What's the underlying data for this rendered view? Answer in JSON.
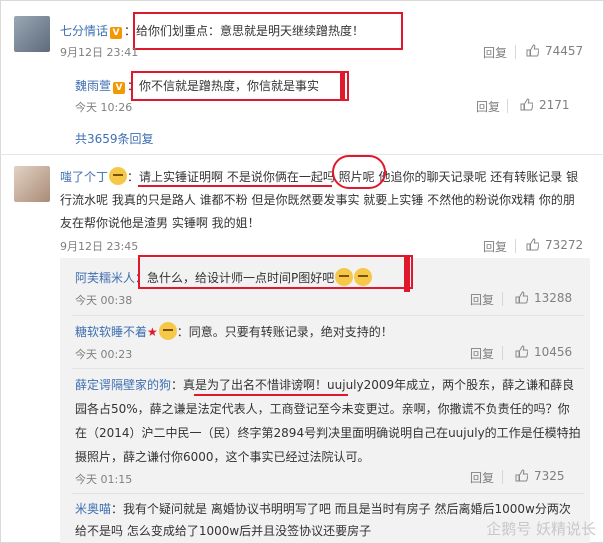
{
  "c1": {
    "name": "七分情话",
    "badge": "V",
    "text": "给你们划重点：意思就是明天继续蹭热度！",
    "time": "9月12日 23:41",
    "reply": "回复",
    "likes": "74457"
  },
  "r1": {
    "name": "魏雨萱",
    "badge": "V",
    "text": "你不信就是蹭热度，你信就是事实",
    "time": "今天 10:26",
    "reply": "回复",
    "likes": "2171"
  },
  "more_replies": "共3659条回复",
  "c2": {
    "name": "嗤了个丁",
    "lines": [
      "请上实锤证明啊 不是说你俩在一起吗 照片呢 他追你的聊天记录呢 还有转账记录 银",
      "行流水呢 我真的只是路人 谁都不粉 但是你既然要发事实 就要上实锤 不然他的粉说你戏精 你的朋",
      "友在帮你说他是渣男 实锤啊 我的姐！"
    ],
    "time": "9月12日 23:45",
    "reply": "回复",
    "likes": "73272"
  },
  "r2": {
    "name": "阿芙糯米人",
    "text": "急什么，给设计师一点时间P图好吧",
    "time": "今天 00:38",
    "reply": "回复",
    "likes": "13288"
  },
  "r3": {
    "name": "糖软软睡不着",
    "text": "同意。只要有转账记录，绝对支持的！",
    "time": "今天 00:23",
    "reply": "回复",
    "likes": "10456"
  },
  "r4": {
    "name": "薛定谔隔壁家的狗",
    "lines": [
      "真是为了出名不惜诽谤啊！uujuly2009年成立，两个股东，薛之谦和薛良",
      "园各占50%，薛之谦是法定代表人，工商登记至今未变更过。亲啊，你撒谎不负责任的吗？你",
      "在（2014）沪二中民一（民）终字第2894号判决里面明确说明自己在uujuly的工作是任模特拍",
      "摄照片，薛之谦付你6000，这个事实已经过法院认可。"
    ],
    "time": "今天 01:15",
    "reply": "回复",
    "likes": "7325"
  },
  "r5": {
    "name": "米奥喵",
    "lines": [
      "我有个疑问就是 离婚协议书明明写了吧 而且是当时有房子 然后离婚后1000w分两次",
      "给不是吗  怎么变成给了1000w后并且没签协议还要房子"
    ]
  },
  "watermark": "企鹅号 妖精说长"
}
